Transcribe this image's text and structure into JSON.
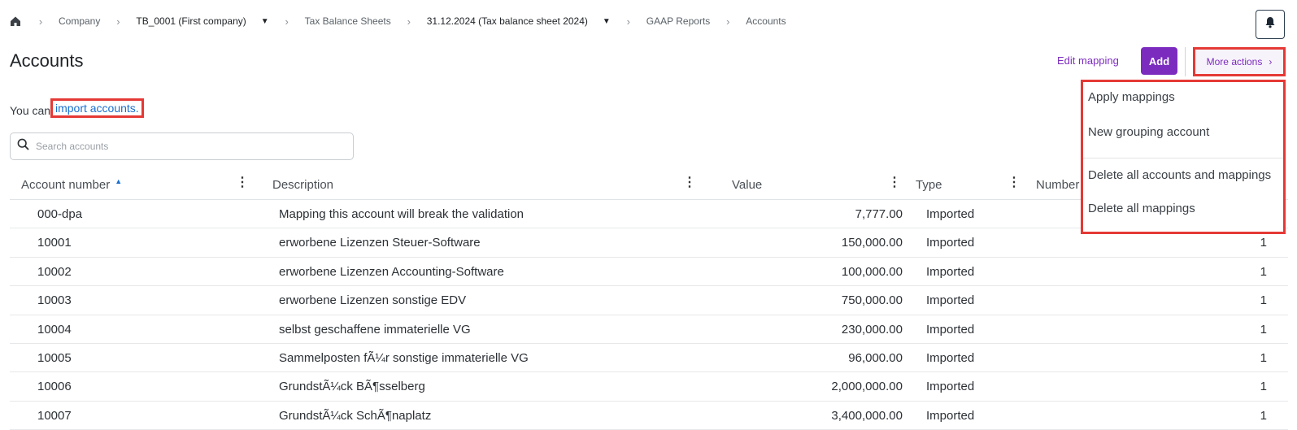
{
  "breadcrumb": {
    "items": [
      "Company",
      "TB_0001 (First company)",
      "Tax Balance Sheets",
      "31.12.2024 (Tax balance sheet 2024)",
      "GAAP Reports",
      "Accounts"
    ]
  },
  "header": {
    "title": "Accounts",
    "edit_mapping_label": "Edit mapping",
    "add_label": "Add",
    "more_actions_label": "More actions"
  },
  "import": {
    "prefix": "You can",
    "link": "import accounts."
  },
  "search": {
    "placeholder": "Search accounts"
  },
  "table": {
    "columns": [
      "Account number",
      "Description",
      "Value",
      "Type",
      "Number"
    ],
    "rows": [
      {
        "number": "000-dpa",
        "description": "Mapping this account will break the validation",
        "value": "7,777.00",
        "type": "Imported",
        "count": ""
      },
      {
        "number": "10001",
        "description": "erworbene Lizenzen Steuer-Software",
        "value": "150,000.00",
        "type": "Imported",
        "count": "1"
      },
      {
        "number": "10002",
        "description": "erworbene Lizenzen Accounting-Software",
        "value": "100,000.00",
        "type": "Imported",
        "count": "1"
      },
      {
        "number": "10003",
        "description": "erworbene Lizenzen sonstige EDV",
        "value": "750,000.00",
        "type": "Imported",
        "count": "1"
      },
      {
        "number": "10004",
        "description": "selbst geschaffene immaterielle VG",
        "value": "230,000.00",
        "type": "Imported",
        "count": "1"
      },
      {
        "number": "10005",
        "description": "Sammelposten fÃ¼r sonstige immaterielle VG",
        "value": "96,000.00",
        "type": "Imported",
        "count": "1"
      },
      {
        "number": "10006",
        "description": "GrundstÃ¼ck BÃ¶sselberg",
        "value": "2,000,000.00",
        "type": "Imported",
        "count": "1"
      },
      {
        "number": "10007",
        "description": "GrundstÃ¼ck SchÃ¶naplatz",
        "value": "3,400,000.00",
        "type": "Imported",
        "count": "1"
      }
    ]
  },
  "more_actions_menu": {
    "items": [
      "Apply mappings",
      "New grouping account",
      "Delete all accounts and mappings",
      "Delete all mappings"
    ]
  },
  "colors": {
    "accent": "#7b2cbf",
    "link": "#1a6fd0",
    "highlight": "#e53935"
  }
}
